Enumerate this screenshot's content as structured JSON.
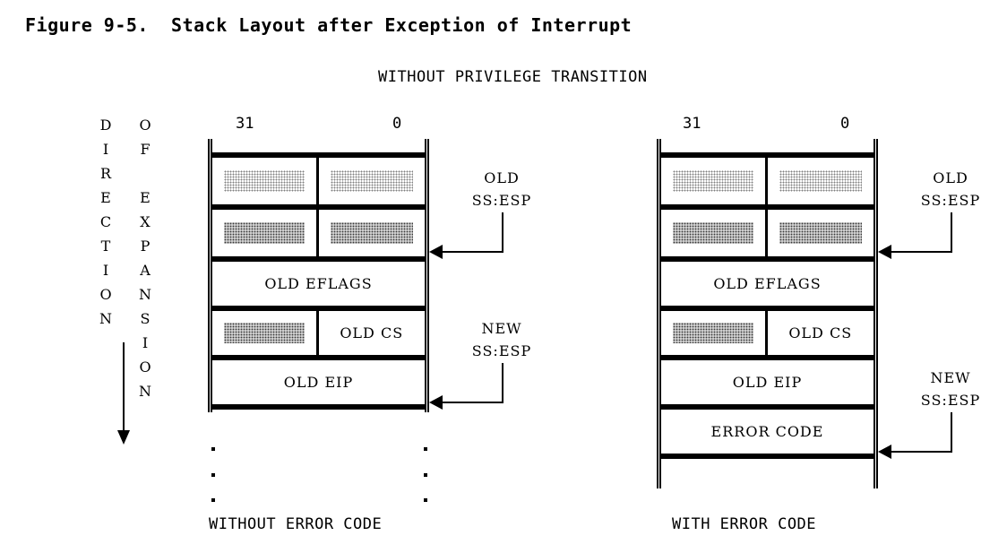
{
  "figure": {
    "title": "Figure 9-5.  Stack Layout after Exception of Interrupt",
    "heading": "WITHOUT PRIVILEGE TRANSITION"
  },
  "legend": {
    "direction_text": "D\nI\nR\nE\nC\nT\nI\nO\nN",
    "expansion_text": "O\nF\n\nE\nX\nP\nA\nN\nS\nI\nO\nN",
    "arrow_icon": "down-arrow-icon"
  },
  "bits": {
    "high": "31",
    "low": "0"
  },
  "stacks": [
    {
      "id": "without-error-code",
      "caption": "WITHOUT ERROR CODE",
      "rows": [
        {
          "type": "cap",
          "left": "",
          "right": ""
        },
        {
          "type": "split",
          "left": "",
          "right": "",
          "left_fill": "hatch",
          "right_fill": "hatch"
        },
        {
          "type": "split",
          "left": "",
          "right": "",
          "left_fill": "dense",
          "right_fill": "dense"
        },
        {
          "type": "full",
          "text": "OLD EFLAGS"
        },
        {
          "type": "split",
          "left": "",
          "right": "OLD CS",
          "left_fill": "dense",
          "right_fill": "none"
        },
        {
          "type": "full",
          "text": "OLD EIP"
        },
        {
          "type": "open",
          "text": ""
        }
      ],
      "pointers": [
        {
          "id": "old-ss-esp",
          "label": "OLD\nSS:ESP"
        },
        {
          "id": "new-ss-esp",
          "label": "NEW\nSS:ESP"
        }
      ],
      "continuation_dots": 3
    },
    {
      "id": "with-error-code",
      "caption": "WITH ERROR CODE",
      "rows": [
        {
          "type": "cap",
          "left": "",
          "right": ""
        },
        {
          "type": "split",
          "left": "",
          "right": "",
          "left_fill": "hatch",
          "right_fill": "hatch"
        },
        {
          "type": "split",
          "left": "",
          "right": "",
          "left_fill": "dense",
          "right_fill": "dense"
        },
        {
          "type": "full",
          "text": "OLD EFLAGS"
        },
        {
          "type": "split",
          "left": "",
          "right": "OLD CS",
          "left_fill": "dense",
          "right_fill": "none"
        },
        {
          "type": "full",
          "text": "OLD EIP"
        },
        {
          "type": "full",
          "text": "ERROR CODE"
        },
        {
          "type": "open",
          "text": ""
        }
      ],
      "pointers": [
        {
          "id": "old-ss-esp",
          "label": "OLD\nSS:ESP"
        },
        {
          "id": "new-ss-esp",
          "label": "NEW\nSS:ESP"
        }
      ],
      "continuation_dots": 0
    }
  ],
  "colors": {
    "ink": "#000000",
    "paper": "#ffffff",
    "hatch_light": "#808080",
    "hatch_dark": "#3a3a3a"
  }
}
